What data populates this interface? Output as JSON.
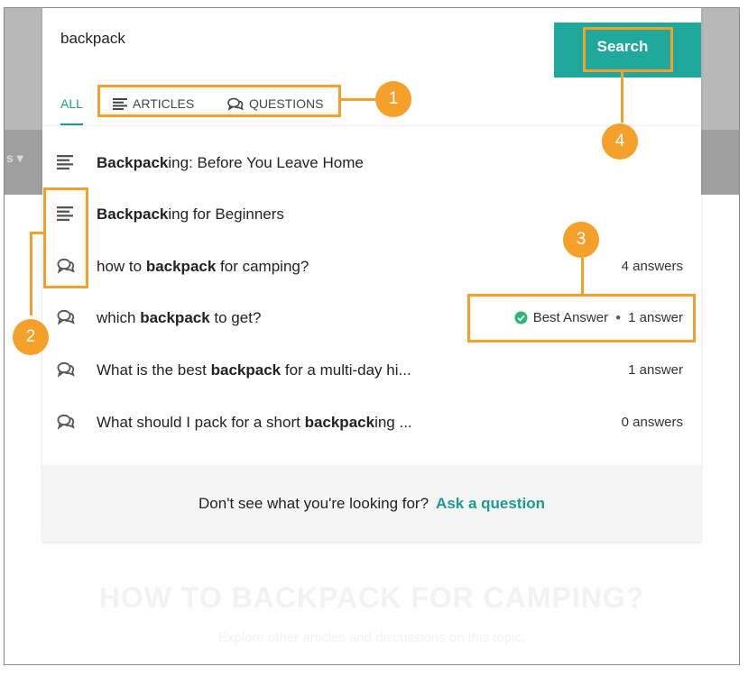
{
  "search": {
    "value": "backpack",
    "button_label": "Search"
  },
  "tabs": [
    {
      "label": "ALL",
      "icon": "none",
      "active": true
    },
    {
      "label": "ARTICLES",
      "icon": "article-lines-icon",
      "active": false
    },
    {
      "label": "QUESTIONS",
      "icon": "question-bubbles-icon",
      "active": false
    }
  ],
  "results": [
    {
      "type": "article",
      "icon": "article-lines-icon",
      "bold": "Backpack",
      "pre": "",
      "post": "ing: Before You Leave Home",
      "meta": ""
    },
    {
      "type": "article",
      "icon": "article-lines-icon",
      "bold": "Backpack",
      "pre": "",
      "post": "ing for Beginners",
      "meta": ""
    },
    {
      "type": "question",
      "icon": "question-bubbles-icon",
      "pre": "how to ",
      "bold": "backpack",
      "post": " for camping?",
      "meta": "4 answers"
    },
    {
      "type": "question",
      "icon": "question-bubbles-icon",
      "pre": "which ",
      "bold": "backpack",
      "post": " to get?",
      "best_answer": "Best Answer",
      "meta": "1 answer"
    },
    {
      "type": "question",
      "icon": "question-bubbles-icon",
      "pre": "What is the best ",
      "bold": "backpack",
      "post": " for a multi-day hi...",
      "meta": "1 answer"
    },
    {
      "type": "question",
      "icon": "question-bubbles-icon",
      "pre": "What should I pack for a short ",
      "bold": "backpack",
      "post": "ing ...",
      "meta": "0 answers"
    }
  ],
  "footer": {
    "text": "Don't see what you're looking for?",
    "link": "Ask a question"
  },
  "callouts": [
    "1",
    "2",
    "3",
    "4"
  ],
  "background": {
    "nav_fragment": "s",
    "heading": "HOW TO BACKPACK FOR CAMPING?",
    "subheading": "Explore other articles and discussions on this topic."
  },
  "colors": {
    "accent": "#1d9b90",
    "button": "#21a89d",
    "callout": "#f5a02a",
    "best_answer": "#2bb673"
  }
}
